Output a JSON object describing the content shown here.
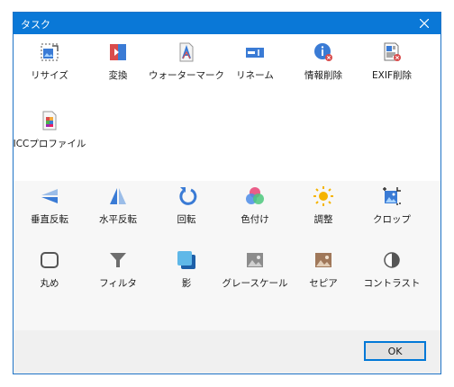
{
  "window": {
    "title": "タスク"
  },
  "row1": [
    "リサイズ",
    "変換",
    "ウォーターマーク",
    "リネーム",
    "情報削除",
    "EXIF削除"
  ],
  "row2": [
    "ICCプロファイル"
  ],
  "row3": [
    "垂直反転",
    "水平反転",
    "回転",
    "色付け",
    "調整",
    "クロップ"
  ],
  "row4": [
    "丸め",
    "フィルタ",
    "影",
    "グレースケール",
    "セピア",
    "コントラスト"
  ],
  "footer": {
    "ok_label": "OK"
  },
  "colors": {
    "titlebar": "#0a78d7",
    "accent_border": "#0078d7"
  }
}
